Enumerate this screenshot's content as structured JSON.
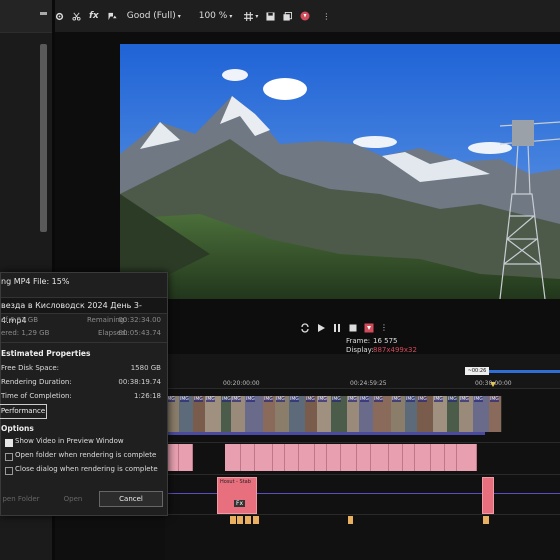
{
  "toolbar": {
    "quality": "Good (Full)",
    "zoom": "100 %"
  },
  "transport": {
    "frame_label": "Frame:",
    "frame_value": "16 575",
    "display_label": "Display:",
    "display_value": "887x499x32"
  },
  "timeline": {
    "cursor_time": "~00:26",
    "ticks": [
      "00:20:00:00",
      "00:24:59:25",
      "00:30:00:00"
    ],
    "video_clip_label": "IMG",
    "media_label": "Fx",
    "audio_clip_label": "Hosut - Stab"
  },
  "dialog": {
    "title": "ng MP4 File: 15%",
    "file_name": "везда в Кисловодск 2024 День 3-4.mp4",
    "progress_left": "of 6,81 GB",
    "remaining_label": "Remaining:",
    "remaining_value": "00:32:34.00",
    "rendered_left": "ered: 1,29 GB",
    "elapsed_label": "Elapsed:",
    "elapsed_value": "00:05:43.74",
    "estimated_heading": "Estimated Properties",
    "free_disk_label": "Free Disk Space:",
    "free_disk_value": "1580 GB",
    "render_duration_label": "Rendering Duration:",
    "render_duration_value": "00:38:19.74",
    "completion_label": "Time of Completion:",
    "completion_value": "1:26:18",
    "performance_button": "Performance",
    "options_heading": "Options",
    "opt_show_video": "Show Video in Preview Window",
    "opt_open_folder": "Open folder when rendering is complete",
    "opt_close_dialog": "Close dialog when rendering is complete",
    "btn_open_folder": "pen Folder",
    "btn_open": "Open",
    "btn_cancel": "Cancel"
  },
  "icons": [
    "gear-icon",
    "scissors-icon",
    "fx-icon",
    "overlay-icon",
    "grid-icon",
    "save-icon",
    "copy-icon",
    "record-icon",
    "loop-icon",
    "play-icon",
    "pause-icon",
    "stop-icon",
    "marker-icon"
  ],
  "colors": {
    "accent_red": "#d24b5a",
    "clip_pink": "#e8a0b0",
    "video_track": "#4a4aa0",
    "cursor_blue": "#2f6fd4"
  }
}
